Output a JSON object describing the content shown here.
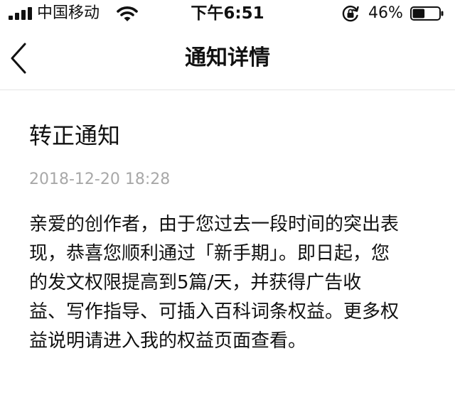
{
  "status_bar": {
    "carrier": "中国移动",
    "time": "下午6:51",
    "battery_percent": "46%",
    "battery_level": 0.46,
    "signal_icon": "signal-bars-icon",
    "wifi_icon": "wifi-icon",
    "lock_icon": "rotation-lock-icon",
    "battery_icon": "battery-icon"
  },
  "nav": {
    "title": "通知详情",
    "back_icon": "chevron-left-icon"
  },
  "notice": {
    "title": "转正通知",
    "date": "2018-12-20 18:28",
    "body_lines": [
      "亲爱的创作者，由于您过去一段时间的突出表",
      "现，恭喜您顺利通过「新手期」。即日起，您",
      "的发文权限提高到5篇/天，并获得广告收",
      "益、写作指导、可插入百科词条权益。更多权",
      "益说明请进入我的权益页面查看。"
    ]
  },
  "colors": {
    "text": "#111111",
    "date": "#a8a8a8",
    "divider": "#e4e4e4",
    "background": "#ffffff"
  }
}
